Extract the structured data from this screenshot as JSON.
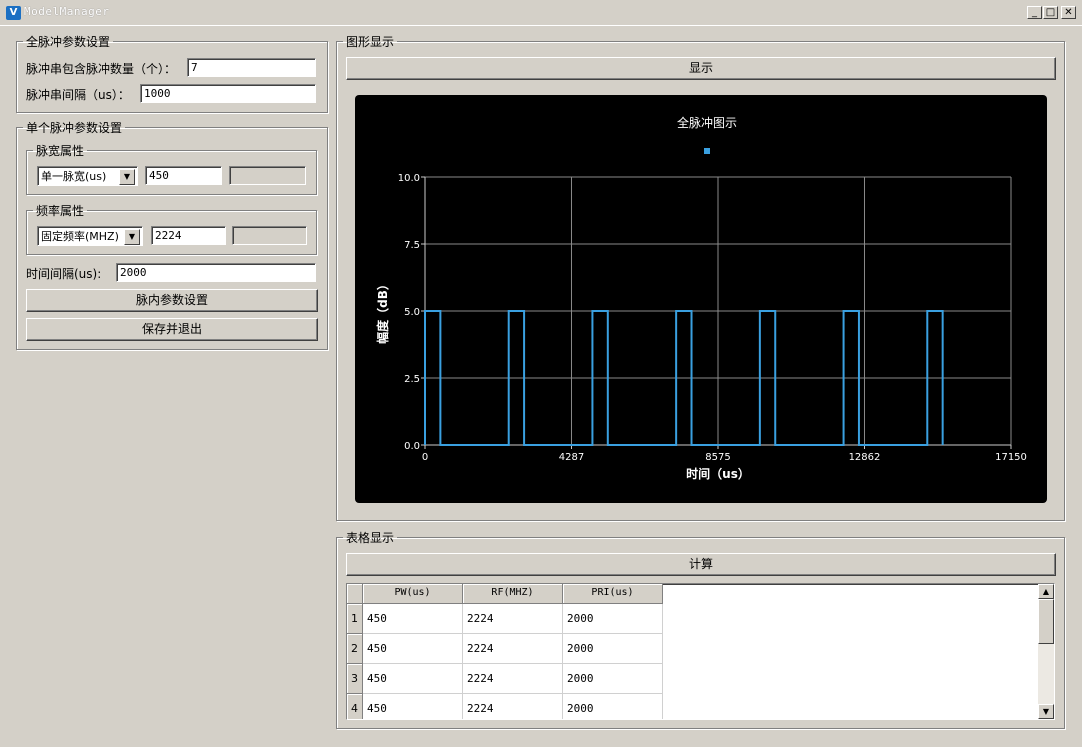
{
  "window": {
    "title": "ModelManager",
    "app_icon_letter": "V",
    "controls": {
      "minimize": "_",
      "maximize": "□",
      "close": "✕"
    }
  },
  "full_pulse": {
    "legend": "全脉冲参数设置",
    "count_label": "脉冲串包含脉冲数量（个）：",
    "count_value": "7",
    "interval_label": "脉冲串间隔（us）：",
    "interval_value": "1000"
  },
  "single_pulse": {
    "legend": "单个脉冲参数设置",
    "width_group": {
      "legend": "脉宽属性",
      "mode": "单一脉宽(us)",
      "value": "450",
      "extra": ""
    },
    "freq_group": {
      "legend": "频率属性",
      "mode": "固定频率(MHZ)",
      "value": "2224",
      "extra": ""
    },
    "time_interval_label": "时间间隔(us):",
    "time_interval_value": "2000",
    "intra_button": "脉内参数设置",
    "save_button": "保存并退出"
  },
  "graph": {
    "legend": "图形显示",
    "show_button": "显示"
  },
  "table_section": {
    "legend": "表格显示",
    "calc_button": "计算",
    "columns": [
      "PW(us)",
      "RF(MHZ)",
      "PRI(us)"
    ],
    "rows": [
      {
        "index": "1",
        "cells": [
          "450",
          "2224",
          "2000"
        ]
      },
      {
        "index": "2",
        "cells": [
          "450",
          "2224",
          "2000"
        ]
      },
      {
        "index": "3",
        "cells": [
          "450",
          "2224",
          "2000"
        ]
      },
      {
        "index": "4",
        "cells": [
          "450",
          "2224",
          "2000"
        ]
      }
    ]
  },
  "chart_data": {
    "type": "line",
    "title": "全脉冲图示",
    "xlabel": "时间（us）",
    "ylabel": "幅度（dB）",
    "xlim": [
      0,
      17150
    ],
    "ylim": [
      0,
      10
    ],
    "x_ticks": [
      "0",
      "4287",
      "8575",
      "12862",
      "17150"
    ],
    "y_ticks": [
      "0.0",
      "2.5",
      "5.0",
      "7.5",
      "10.0"
    ],
    "grid": true,
    "background": "#000000",
    "series_color": "#3aa0e0",
    "text_color": "#ffffff",
    "legend_marker": "top-center",
    "series": [
      {
        "x": [
          0,
          0,
          450,
          450,
          2450,
          2450,
          2900,
          2900,
          4900,
          4900,
          5350,
          5350,
          7350,
          7350,
          7800,
          7800,
          9800,
          9800,
          10250,
          10250,
          12250,
          12250,
          12700,
          12700,
          14700,
          14700,
          15150,
          15150
        ],
        "y": [
          0,
          5,
          5,
          0,
          0,
          5,
          5,
          0,
          0,
          5,
          5,
          0,
          0,
          5,
          5,
          0,
          0,
          5,
          5,
          0,
          0,
          5,
          5,
          0,
          0,
          5,
          5,
          0
        ]
      }
    ]
  }
}
